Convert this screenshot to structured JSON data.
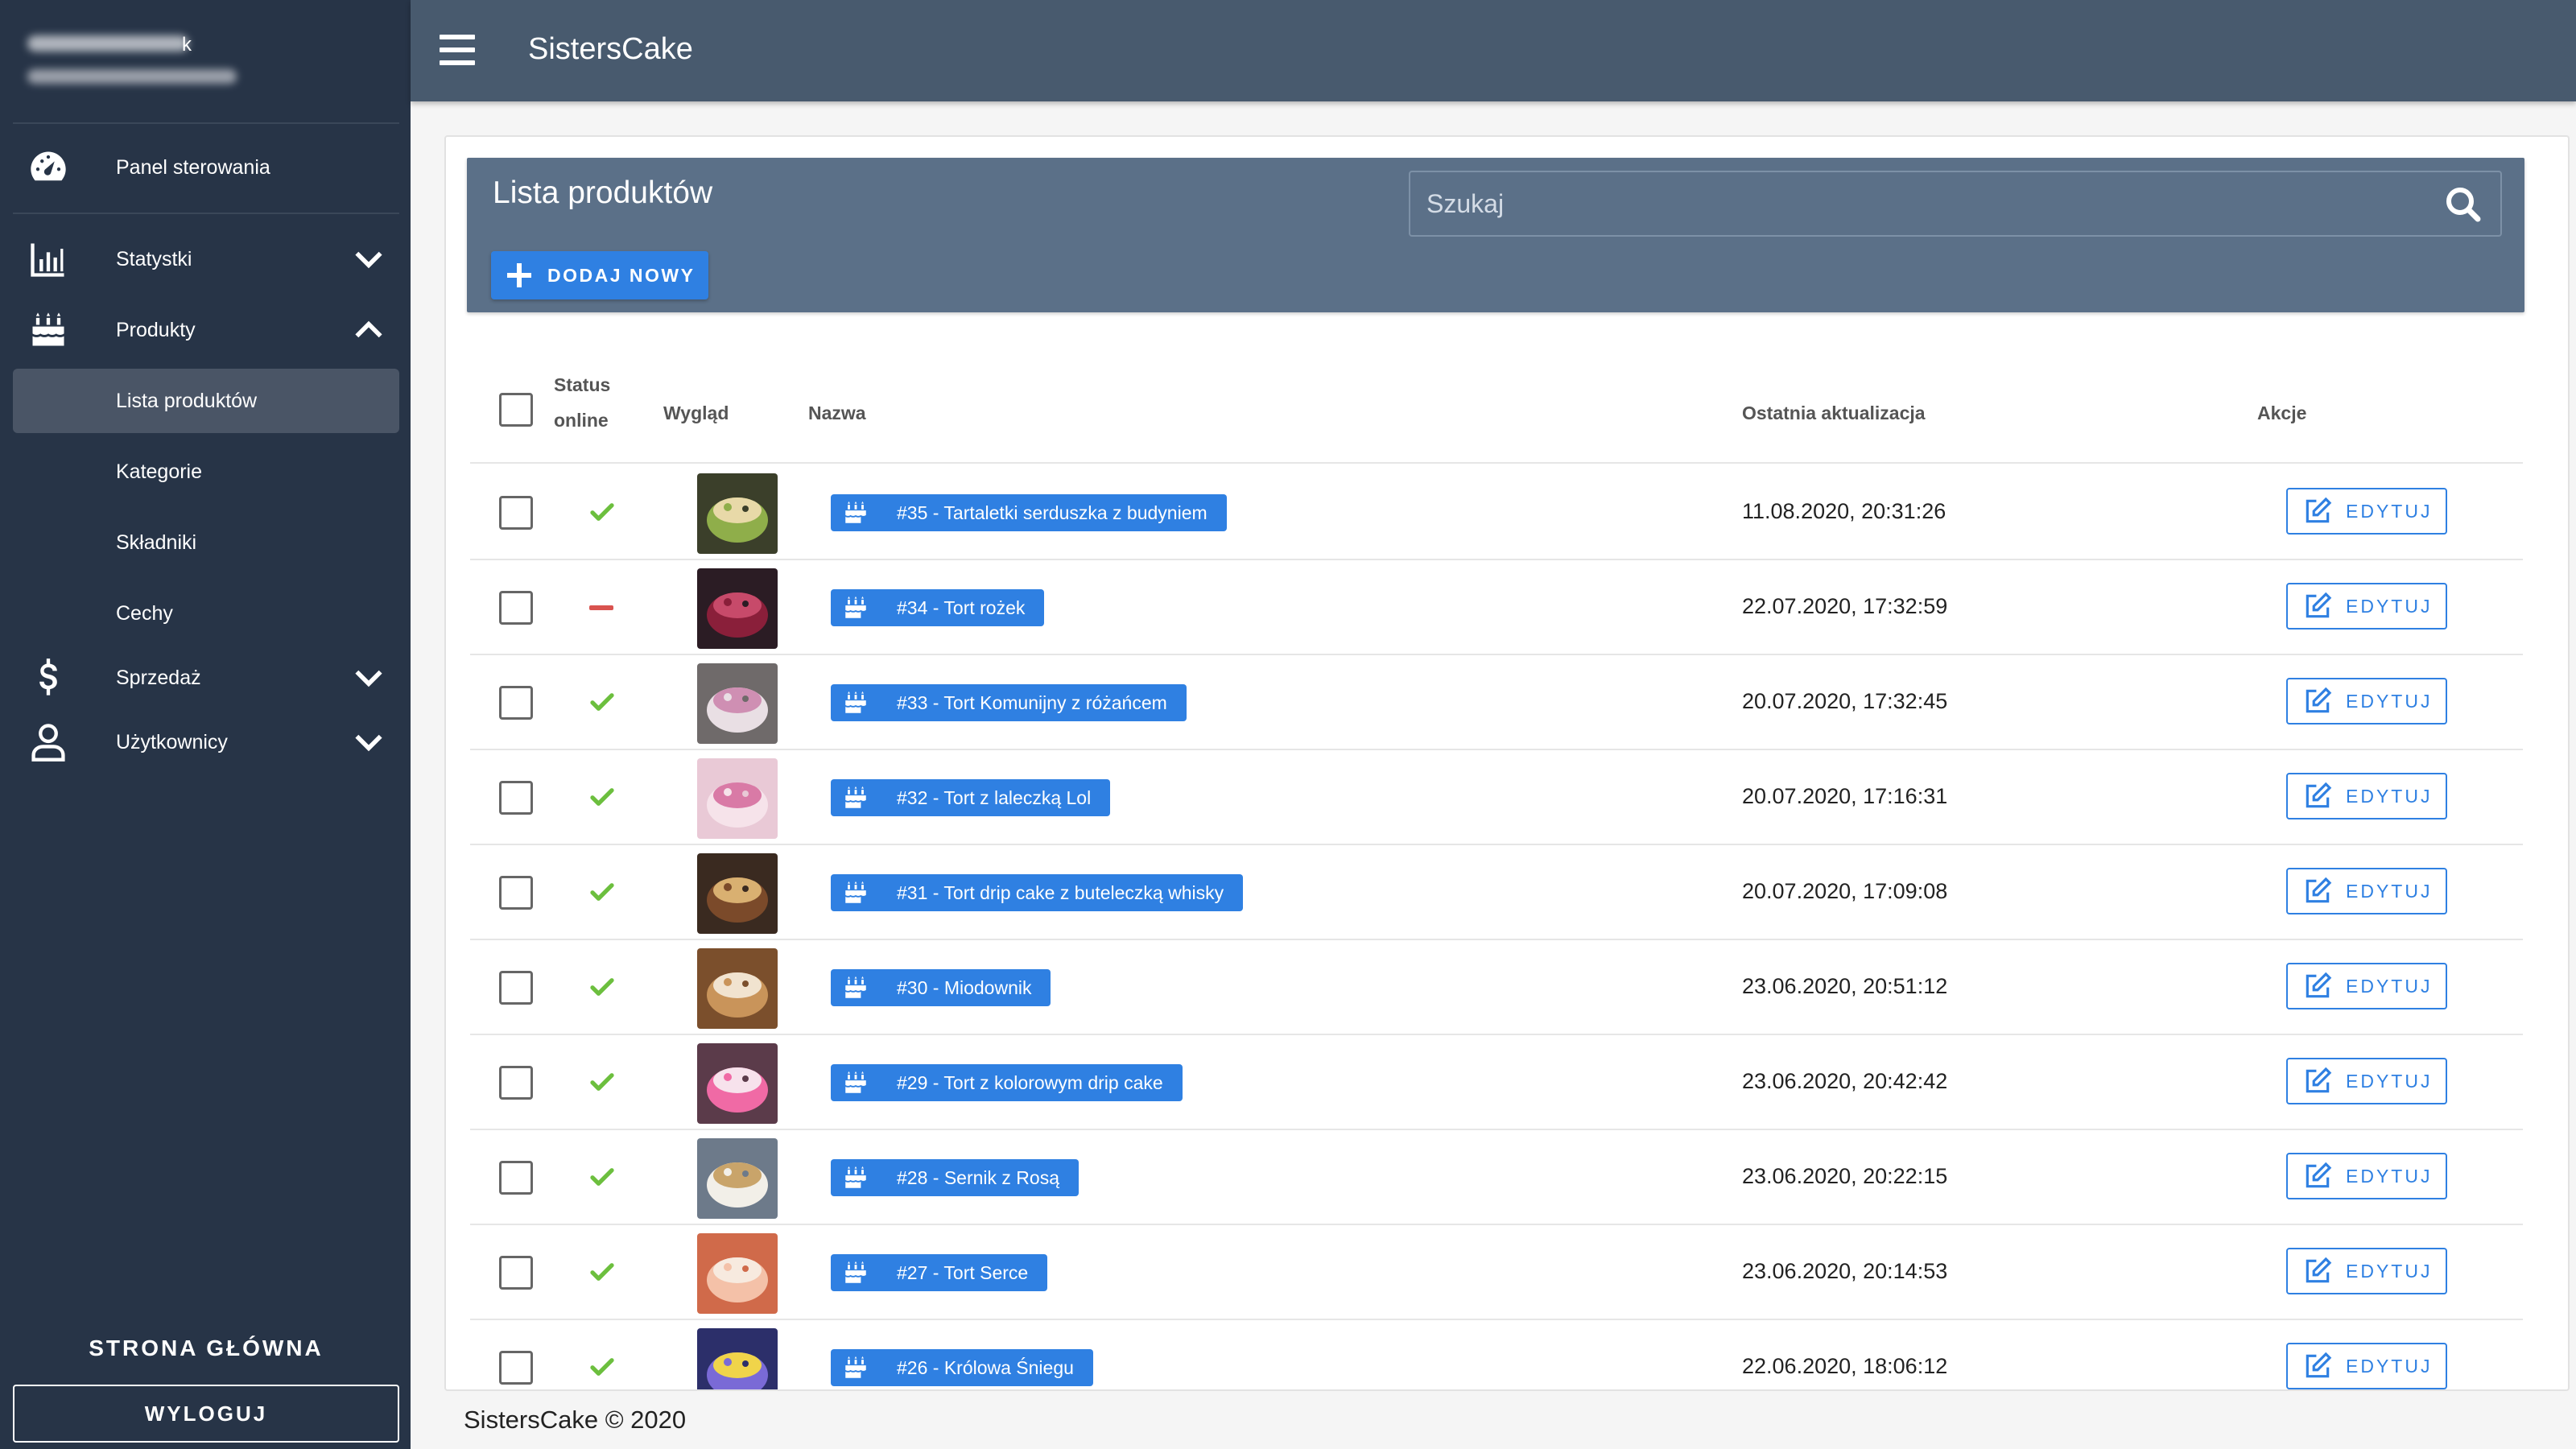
{
  "app": {
    "title": "SistersCake"
  },
  "sidebar": {
    "user": {
      "name_suffix": "k"
    },
    "items": [
      {
        "label": "Panel sterowania",
        "icon": "gauge-icon"
      },
      {
        "label": "Statystki",
        "icon": "bar-chart-icon"
      },
      {
        "label": "Produkty",
        "icon": "cake-icon"
      },
      {
        "label": "Sprzedaż",
        "icon": "dollar-icon"
      },
      {
        "label": "Użytkownicy",
        "icon": "user-icon"
      }
    ],
    "sub_items": [
      {
        "label": "Lista produktów",
        "active": true
      },
      {
        "label": "Kategorie"
      },
      {
        "label": "Składniki"
      },
      {
        "label": "Cechy"
      }
    ],
    "home_label": "STRONA GŁÓWNA",
    "logout_label": "WYLOGUJ"
  },
  "main": {
    "title": "Lista produktów",
    "search": {
      "placeholder": "Szukaj",
      "value": ""
    },
    "add_label": "DODAJ NOWY",
    "columns": {
      "status_line1": "Status",
      "status_line2": "online",
      "look": "Wygląd",
      "name": "Nazwa",
      "updated": "Ostatnia aktualizacja",
      "actions": "Akcje"
    },
    "edit_label": "EDYTUJ",
    "rows": [
      {
        "name": "#35 - Tartaletki serduszka z budyniem",
        "updated": "11.08.2020, 20:31:26",
        "online": true
      },
      {
        "name": "#34 - Tort rożek",
        "updated": "22.07.2020, 17:32:59",
        "online": false
      },
      {
        "name": "#33 - Tort Komunijny z różańcem",
        "updated": "20.07.2020, 17:32:45",
        "online": true
      },
      {
        "name": "#32 - Tort z laleczką Lol",
        "updated": "20.07.2020, 17:16:31",
        "online": true
      },
      {
        "name": "#31 - Tort drip cake z buteleczką whisky",
        "updated": "20.07.2020, 17:09:08",
        "online": true
      },
      {
        "name": "#30 - Miodownik",
        "updated": "23.06.2020, 20:51:12",
        "online": true
      },
      {
        "name": "#29 - Tort z kolorowym drip cake",
        "updated": "23.06.2020, 20:42:42",
        "online": true
      },
      {
        "name": "#28 - Sernik z Rosą",
        "updated": "23.06.2020, 20:22:15",
        "online": true
      },
      {
        "name": "#27 - Tort Serce",
        "updated": "23.06.2020, 20:14:53",
        "online": true
      },
      {
        "name": "#26 - Królowa Śniegu",
        "updated": "22.06.2020, 18:06:12",
        "online": true
      }
    ]
  },
  "footer": {
    "text": "SistersCake © 2020"
  },
  "colors": {
    "sidebar": "#273447",
    "topbar": "#485a6e",
    "header": "#5b7088",
    "accent": "#2f80e2",
    "online": "#6cbf3e",
    "offline": "#d9534f"
  }
}
